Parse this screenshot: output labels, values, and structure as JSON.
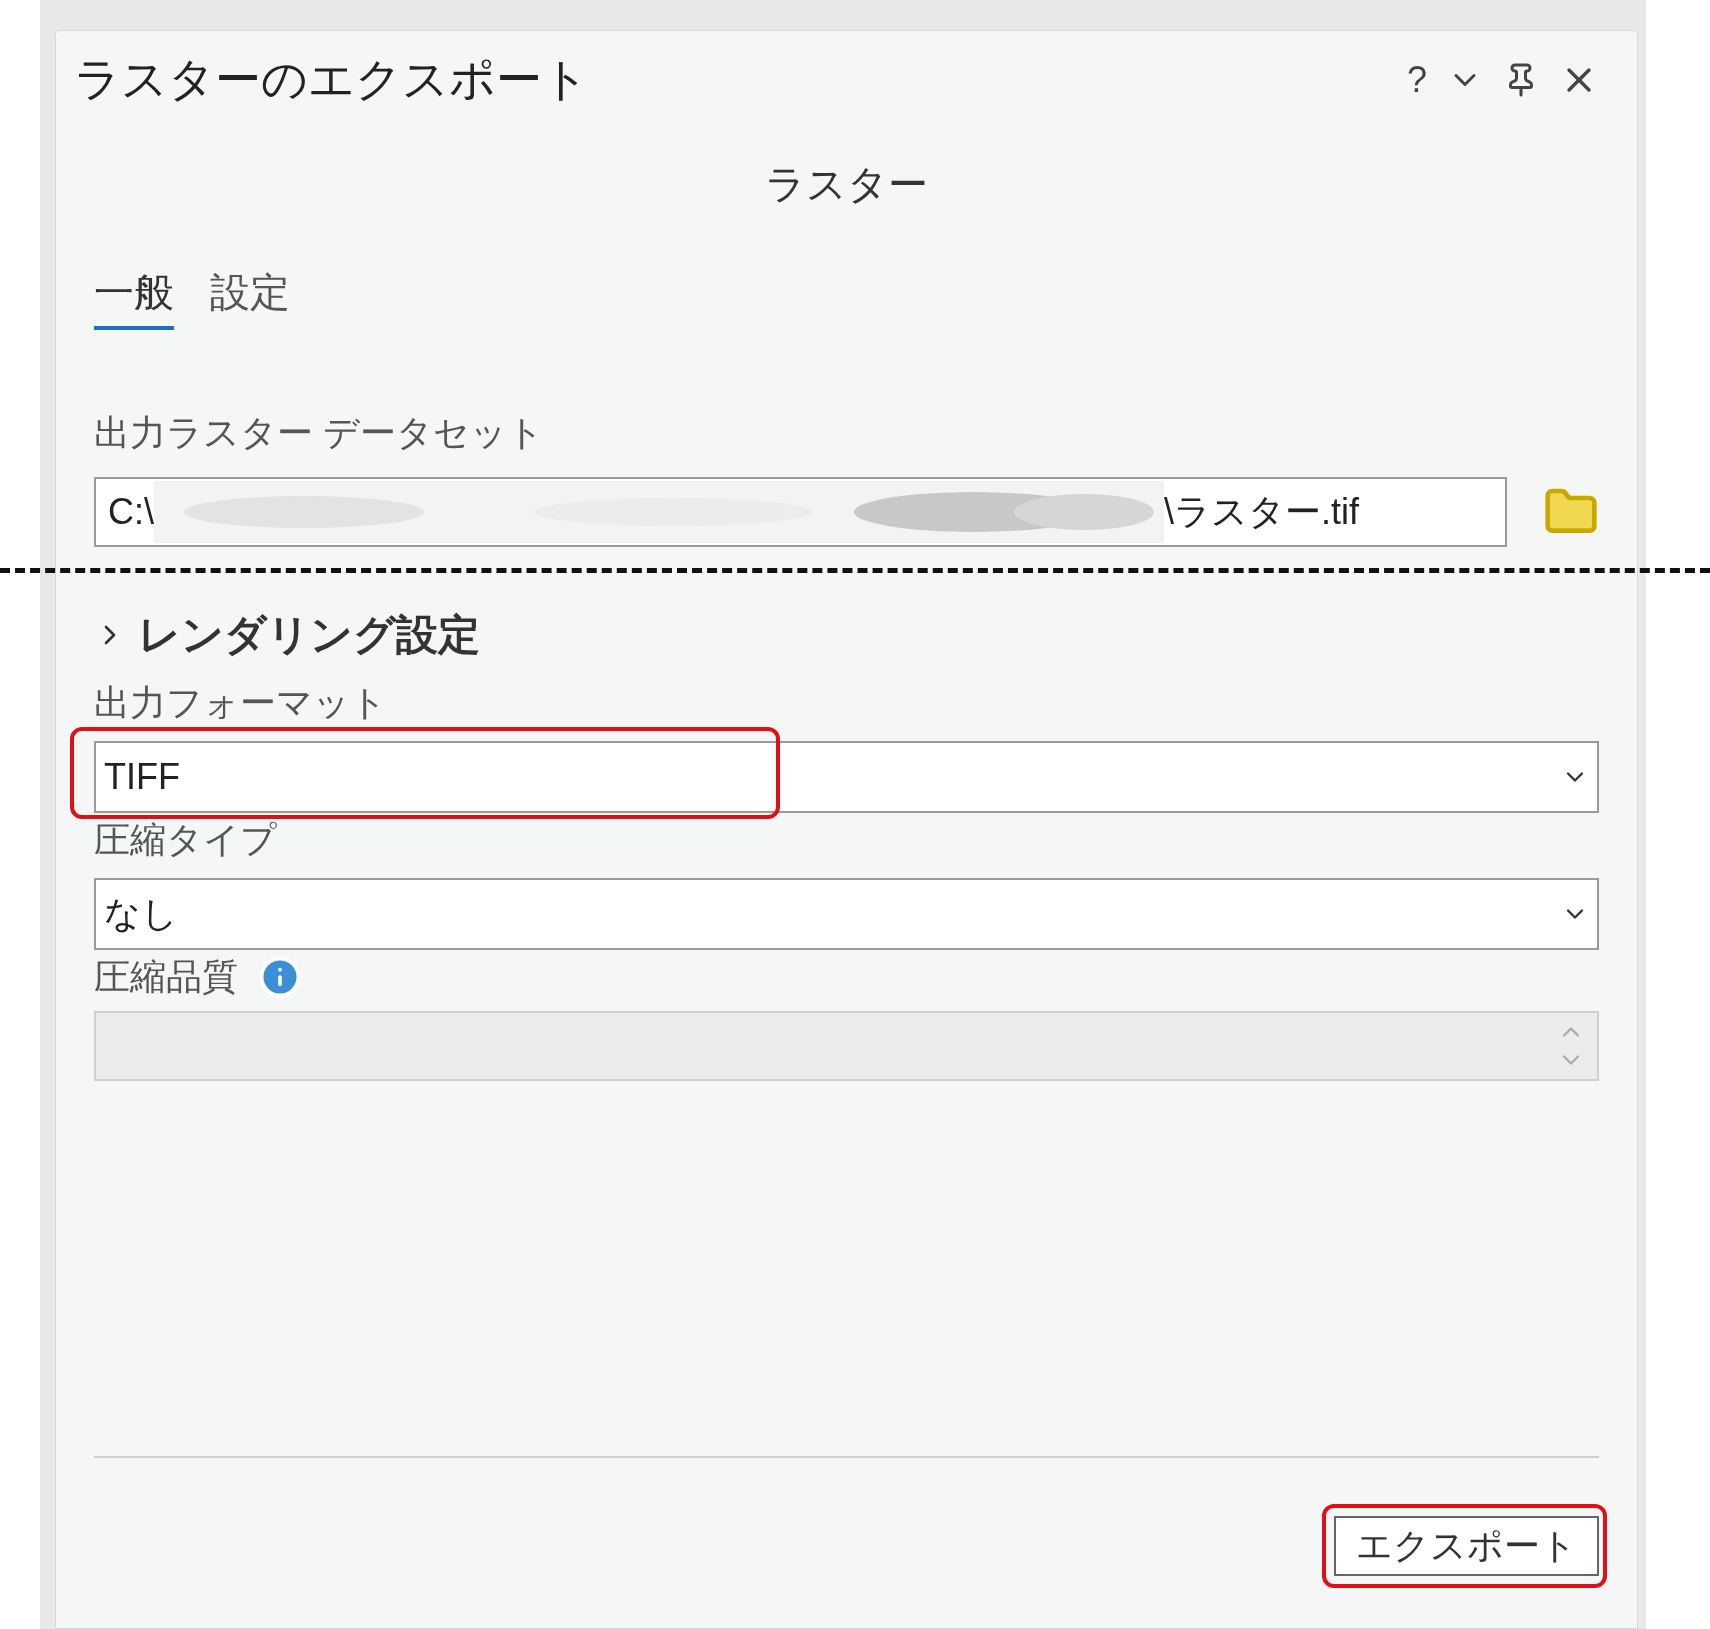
{
  "window": {
    "title": "ラスターのエクスポート",
    "controls": [
      "?"
    ]
  },
  "subtitle": "ラスター",
  "tabs": [
    {
      "label": "一般",
      "selected": true
    },
    {
      "label": "設定",
      "selected": false
    }
  ],
  "output_dataset": {
    "label": "出力ラスター データセット",
    "path_start": "C:\\",
    "path_end": "\\ラスター.tif"
  },
  "cut_marker": true,
  "rendering": {
    "label": "レンダリング設定",
    "expanded": false
  },
  "output_format": {
    "label": "出力フォーマット",
    "value": "TIFF",
    "highlighted": true
  },
  "compression_type": {
    "label": "圧縮タイプ",
    "value": "なし"
  },
  "compression_quality": {
    "label": "圧縮品質",
    "disabled": true
  },
  "export_button": {
    "label": "エクスポート",
    "highlighted": true
  }
}
